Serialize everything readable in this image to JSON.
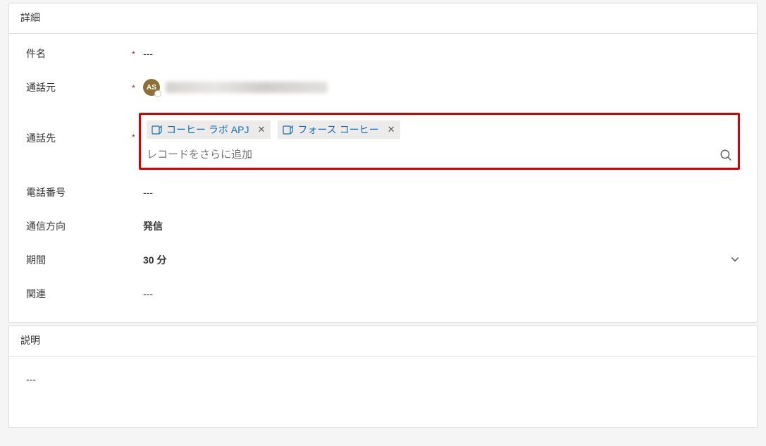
{
  "details": {
    "section_title": "詳細",
    "fields": {
      "subject": {
        "label": "件名",
        "required": true,
        "value": "---"
      },
      "call_from": {
        "label": "通話元",
        "required": true,
        "avatar_text": "AS"
      },
      "call_to": {
        "label": "通話先",
        "required": true,
        "tags": [
          {
            "label": "コーヒー ラボ APJ"
          },
          {
            "label": "フォース コーヒー"
          }
        ],
        "search_placeholder": "レコードをさらに追加"
      },
      "phone": {
        "label": "電話番号",
        "value": "---"
      },
      "direction": {
        "label": "通信方向",
        "value": "発信"
      },
      "duration": {
        "label": "期間",
        "value": "30 分"
      },
      "related": {
        "label": "関連",
        "value": "---"
      }
    }
  },
  "description": {
    "section_title": "説明",
    "value": "---"
  }
}
